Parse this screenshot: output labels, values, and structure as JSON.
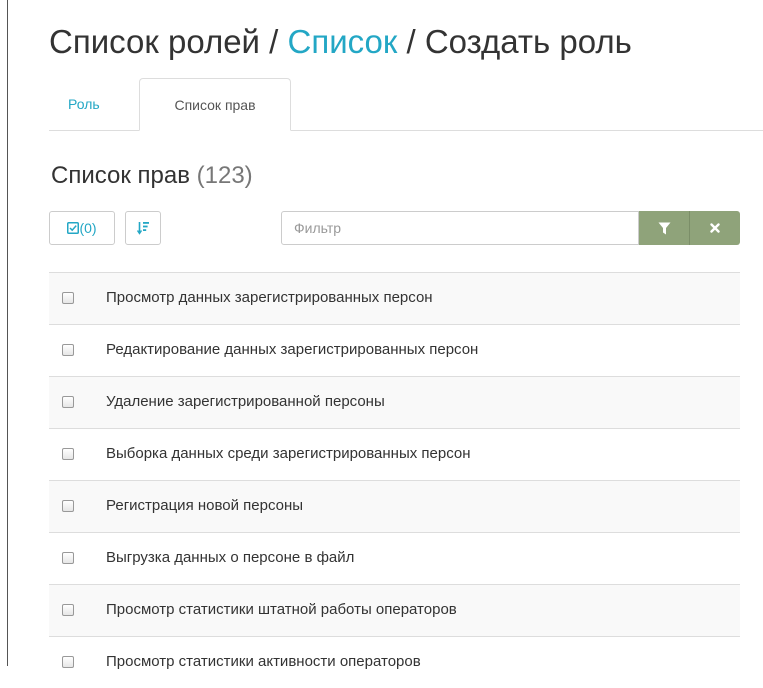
{
  "breadcrumb": {
    "part1": "Список ролей",
    "sep1": " / ",
    "part2": "Список",
    "sep2": " / ",
    "part3": "Создать роль"
  },
  "tabs": [
    {
      "label": "Роль",
      "active": false
    },
    {
      "label": "Список прав",
      "active": true
    }
  ],
  "section": {
    "title": "Список прав",
    "count": "(123)"
  },
  "toolbar": {
    "select_count": "(0)",
    "select_icon": "checkbox-icon",
    "sort_icon": "sort-icon",
    "filter_placeholder": "Фильтр",
    "filter_value": "",
    "apply_icon": "funnel-icon",
    "clear_icon": "times-icon"
  },
  "permissions": [
    {
      "label": "Просмотр данных зарегистрированных персон",
      "checked": false
    },
    {
      "label": "Редактирование данных зарегистрированных персон",
      "checked": false
    },
    {
      "label": "Удаление зарегистрированной персоны",
      "checked": false
    },
    {
      "label": "Выборка данных среди зарегистрированных персон",
      "checked": false
    },
    {
      "label": "Регистрация новой персоны",
      "checked": false
    },
    {
      "label": "Выгрузка данных о персоне в файл",
      "checked": false
    },
    {
      "label": "Просмотр статистики штатной работы операторов",
      "checked": false
    },
    {
      "label": "Просмотр статистики активности операторов",
      "checked": false
    }
  ],
  "colors": {
    "link": "#23a7c5",
    "filter_buttons": "#8fa37a"
  }
}
